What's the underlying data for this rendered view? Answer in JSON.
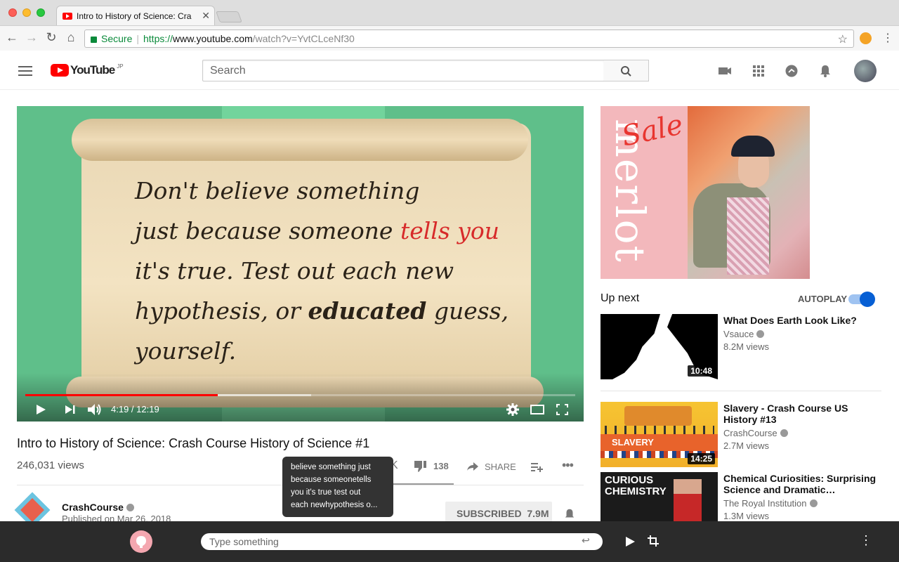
{
  "browser": {
    "tab_title": "Intro to History of Science: Cra",
    "secure_label": "Secure",
    "url_scheme": "https://",
    "url_host": "www.youtube.com",
    "url_path": "/watch?v=YvtCLceNf30"
  },
  "header": {
    "logo_text": "YouTube",
    "logo_region": "JP",
    "search_placeholder": "Search"
  },
  "player": {
    "quote_lines": [
      "Don't believe something",
      "just because someone ",
      "it's true. Test out each new",
      "hypothesis, or ",
      "yourself."
    ],
    "quote_red": "tells you",
    "quote_bold": "educated",
    "quote_after_bold": " guess,",
    "time_current": "4:19",
    "time_sep": " / ",
    "time_total": "12:19",
    "progress": 0.35,
    "buffered": 0.52
  },
  "video": {
    "title": "Intro to History of Science: Crash Course History of Science #1",
    "views": "246,031 views",
    "dislikes": "138",
    "share_label": "SHARE",
    "channel": "CrashCourse",
    "published": "Published on Mar 26, 2018",
    "subscribed_label": "SUBSCRIBED",
    "subscriber_count": "7.9M"
  },
  "tooltip": {
    "lines": [
      "believe something just",
      "because someonetells",
      "you it's true test out",
      "each newhypothesis o..."
    ]
  },
  "ad": {
    "brand": "merlot",
    "sale_text": "Sale"
  },
  "sidebar": {
    "up_next_label": "Up next",
    "autoplay_label": "AUTOPLAY",
    "autoplay_on": true,
    "videos": [
      {
        "title": "What Does Earth Look Like?",
        "channel": "Vsauce",
        "views": "8.2M views",
        "duration": "10:48"
      },
      {
        "title": "Slavery - Crash Course US History #13",
        "channel": "CrashCourse",
        "views": "2.7M views",
        "duration": "14:25",
        "thumb_text": "SLAVERY"
      },
      {
        "title": "Chemical Curiosities: Surprising Science and Dramatic…",
        "channel": "The Royal Institution",
        "views": "1.3M views",
        "thumb_text": "CURIOUS CHEMISTRY"
      }
    ]
  },
  "bottom_bar": {
    "input_placeholder": "Type something"
  },
  "colors": {
    "brand_red": "#ff0000",
    "accent_blue": "#065fd4",
    "quote_red": "#d72a2a",
    "player_bg": "#5fbf8a"
  }
}
